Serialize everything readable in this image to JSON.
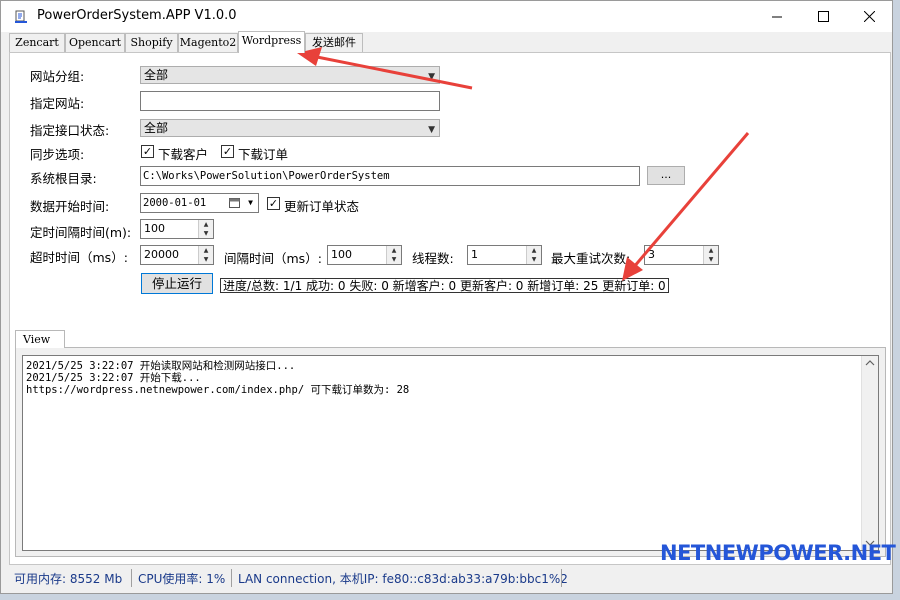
{
  "window": {
    "title": "PowerOrderSystem.APP V1.0.0"
  },
  "edge_numbers": [
    "42",
    "43",
    "43",
    "44",
    "44",
    "47",
    "47",
    "48",
    "50",
    "51",
    "51",
    "52",
    "55",
    "55",
    "57",
    "59",
    "59"
  ],
  "tabs": [
    "Zencart",
    "Opencart",
    "Shopify",
    "Magento2",
    "Wordpress",
    "发送邮件"
  ],
  "active_tab": "Wordpress",
  "form": {
    "site_group_label": "网站分组:",
    "site_group_value": "全部",
    "site_label": "指定网站:",
    "site_value": "",
    "api_status_label": "指定接口状态:",
    "api_status_value": "全部",
    "sync_label": "同步选项:",
    "sync_customers_label": "下载客户",
    "sync_orders_label": "下载订单",
    "root_dir_label": "系统根目录:",
    "root_dir_value": "C:\\Works\\PowerSolution\\PowerOrderSystem",
    "browse_label": "...",
    "start_time_label": "数据开始时间:",
    "start_time_value": "2000-01-01",
    "update_status_label": "更新订单状态",
    "interval_label": "定时间隔时间(m):",
    "interval_value": "100",
    "timeout_label": "超时时间（ms）:",
    "timeout_value": "20000",
    "gap_label": "间隔时间（ms）:",
    "gap_value": "100",
    "threads_label": "线程数:",
    "threads_value": "1",
    "retries_label": "最大重试次数:",
    "retries_value": "3",
    "stop_button": "停止运行"
  },
  "progress": {
    "text": "进度/总数: 1/1 成功: 0 失败: 0 新增客户: 0 更新客户: 0 新增订单: 25 更新订单: 0"
  },
  "log": {
    "tab": "View",
    "lines": [
      "2021/5/25 3:22:07 开始读取网站和检测网站接口...",
      "2021/5/25 3:22:07 开始下载...",
      "https://wordpress.netnewpower.com/index.php/ 可下载订单数为: 28"
    ]
  },
  "status": {
    "memory": "可用内存: 8552 Mb",
    "cpu": "CPU使用率: 1%",
    "network": "LAN connection, 本机IP: fe80::c83d:ab33:a79b:bbc1%2"
  },
  "watermark": "NETNEWPOWER.NET",
  "colors": {
    "annotation_arrow": "#e8413a",
    "status_text": "#1a3a8a",
    "watermark": "#2456d8"
  }
}
